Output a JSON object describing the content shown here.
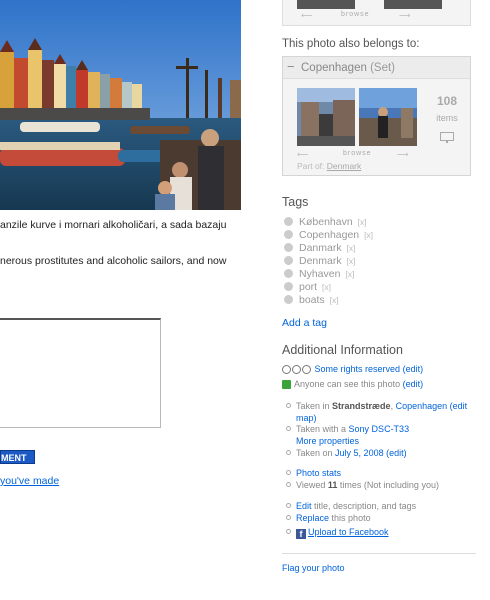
{
  "photo": {
    "caption_sr": "anzile kurve i mornari alkoholičari, a sada bazaju",
    "caption_en": "nerous prostitutes and alcoholic sailors, and now"
  },
  "comment": {
    "button_label": "MENT",
    "made_link": "you've made"
  },
  "top_strip": {
    "browse": "browse"
  },
  "sets": {
    "belongs_label": "This photo also belongs to:",
    "set_name": "Copenhagen",
    "set_kind": "(Set)",
    "count": "108",
    "count_label": "items",
    "browse": "browse",
    "part_of_label": "Part of:",
    "part_of_link": "Denmark"
  },
  "tags": {
    "heading": "Tags",
    "remove_label": "[x]",
    "items": [
      "København",
      "Copenhagen",
      "Danmark",
      "Denmark",
      "Nyhaven",
      "port",
      "boats"
    ],
    "add_tag": "Add a tag"
  },
  "info": {
    "heading": "Additional Information",
    "license_link": "Some rights reserved",
    "edit": "(edit)",
    "privacy_text": "Anyone can see this photo",
    "taken_in_prefix": "Taken in",
    "place": "Strandstræde",
    "city": "Copenhagen",
    "edit_open": "(edit",
    "map_link": "map",
    "map_close": ")",
    "taken_with_prefix": "Taken with a",
    "camera": "Sony DSC-T33",
    "more_props": "More properties",
    "taken_on_prefix": "Taken on",
    "date": "July 5, 2008",
    "stats_link": "Photo stats",
    "viewed_prefix": "Viewed",
    "views": "11",
    "viewed_suffix": "times  (Not including you)",
    "edit_link": "Edit",
    "edit_suffix": "title, description, and tags",
    "replace_link": "Replace",
    "replace_suffix": "this photo",
    "facebook_link": "Upload to Facebook",
    "flag": "Flag your photo"
  }
}
